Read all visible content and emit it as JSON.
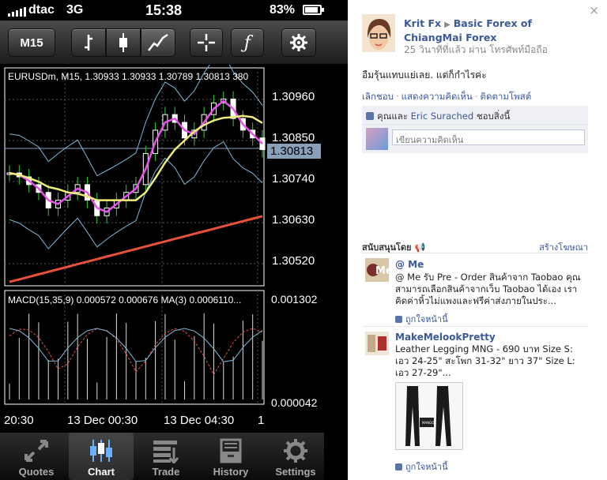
{
  "status_bar": {
    "carrier": "dtac",
    "network": "3G",
    "time": "15:38",
    "battery": "83%"
  },
  "toolbar": {
    "timeframe": "M15",
    "icons": [
      "bar-chart-icon",
      "candlestick-icon",
      "line-chart-icon",
      "crosshair-icon",
      "indicator-icon",
      "settings-icon"
    ]
  },
  "chart_header": "EURUSDm, M15, 1.30933 1.30933 1.30789 1.30813 380",
  "price_labels": [
    "1.30960",
    "1.30850",
    "1.30740",
    "1.30630",
    "1.30520"
  ],
  "current_price": "1.30813",
  "macd_header": "MACD(15,35,9) 0.000572 0.000676 MA(3) 0.0006110...",
  "macd_labels": [
    "0.001302",
    "0.000042"
  ],
  "time_labels": [
    "20:30",
    "13 Dec 00:30",
    "13 Dec 04:30",
    "1"
  ],
  "tabs": [
    {
      "label": "Quotes",
      "icon": "quotes-icon"
    },
    {
      "label": "Chart",
      "icon": "chart-icon"
    },
    {
      "label": "Trade",
      "icon": "trade-icon"
    },
    {
      "label": "History",
      "icon": "history-icon"
    },
    {
      "label": "Settings",
      "icon": "settings-gear-icon"
    }
  ],
  "chart_data": {
    "type": "line",
    "title": "EURUSDm, M15",
    "note": "Candlestick chart with moving averages and Bollinger bands; MACD subpanel",
    "ylim": [
      1.3046,
      1.3102
    ],
    "series": [
      {
        "name": "price",
        "values": [
          1.3075,
          1.3074,
          1.3072,
          1.307,
          1.3066,
          1.3068,
          1.307,
          1.3072,
          1.3068,
          1.3064,
          1.3066,
          1.3068,
          1.307,
          1.3072,
          1.308,
          1.3086,
          1.309,
          1.3088,
          1.3084,
          1.3086,
          1.309,
          1.3093,
          1.3094,
          1.3089,
          1.3086,
          1.3084,
          1.3081
        ]
      }
    ]
  },
  "fb_post": {
    "author": "Krit Fx",
    "group": "Basic Forex of ChiangMai Forex",
    "meta": "25 วินาทีที่แล้ว ผ่าน โทรศัพท์มือถือ",
    "text": "อืมรุ้นแทบแย่เลย. แต่ก็กำไรค่ะ",
    "actions": [
      "เลิกชอบ",
      "แสดงความคิดเห็น",
      "ติดตามโพสต์"
    ],
    "likes_you_and": "คุณและ",
    "likes_name": "Eric Surached",
    "likes_tail": "ชอบสิ่งนี้",
    "comment_placeholder": "เขียนความคิดเห็น"
  },
  "ads": {
    "header": "สนับสนุนโดย",
    "create_link": "สร้างโฆษณา",
    "items": [
      {
        "title": "@ Me",
        "body": "@ Me รับ Pre - Order สินค้าจาก Taobao คุณสามารถเลือกสินค้าจากเว็บ Taobao ได้เอง เราคิดค่าหิ้วไม่แพงและฟรีค่าส่งภายในประ...",
        "like": "ถูกใจหน้านี้"
      },
      {
        "title": "MakeMelookPretty",
        "body": "Leather Legging MNG - 690 บาท Size S: เอว 24-25\" สะโพก 31-32\" ยาว 37\" Size L: เอว 27-29\"...",
        "like": "ถูกใจหน้านี้",
        "photo_text": "MANGO"
      }
    ]
  },
  "colors": {
    "fb_blue": "#3b5998",
    "ma_magenta": "#e455e8",
    "ma_yellow": "#f0ee78",
    "ma_red": "#e8503a",
    "bands": "#7fb9d8"
  }
}
